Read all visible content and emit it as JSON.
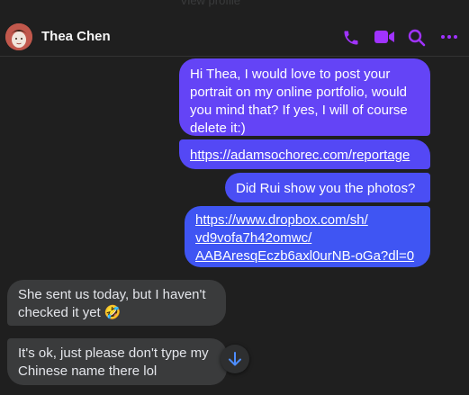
{
  "ghost_text": "View profile",
  "header": {
    "contact_name": "Thea Chen",
    "icons": [
      "phone-icon",
      "video-call-icon",
      "search-icon",
      "more-options-icon"
    ],
    "accent_color": "#a033ff"
  },
  "messages": [
    {
      "direction": "outgoing",
      "text": "Hi Thea, I would love to post your portrait on my online portfolio, would you mind that? If yes, I will of course delete it:)"
    },
    {
      "direction": "outgoing",
      "type": "link",
      "text": "https://adamsochorec.com/reportage"
    },
    {
      "direction": "outgoing",
      "text": "Did Rui show you the photos?"
    },
    {
      "direction": "outgoing",
      "type": "link",
      "lines": [
        "https://www.dropbox.com/sh/",
        "vd9vofa7h42omwc/",
        "AABAresqEczb6axl0urNB-oGa?dl=0"
      ]
    },
    {
      "direction": "incoming",
      "text": "She sent us today, but I haven't checked it yet",
      "emoji": "🤣"
    },
    {
      "direction": "incoming",
      "lines": [
        "It's ok, just please don't type my",
        "Chinese name there lol"
      ]
    }
  ],
  "colors": {
    "background": "#1f1f1f",
    "outgoing_bubble": "#5b43f4",
    "incoming_bubble": "#3a3b3c"
  }
}
